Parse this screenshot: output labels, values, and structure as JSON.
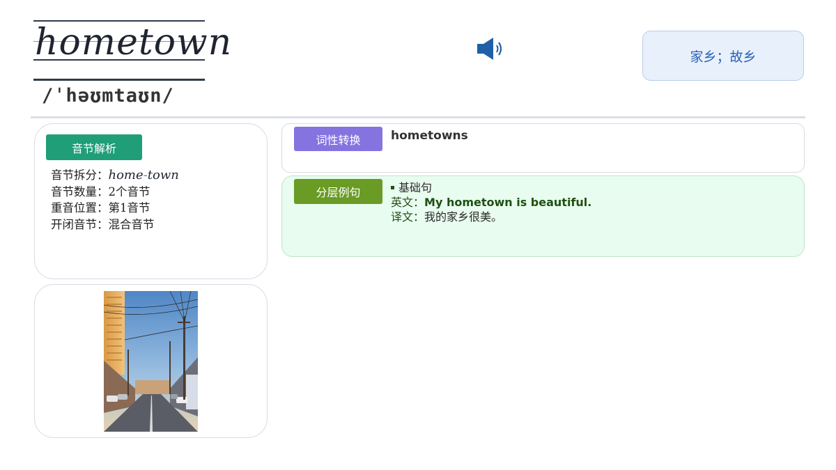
{
  "word": {
    "text": "hometown",
    "phonetic": "/ˈhəʊmtaʊn/"
  },
  "meaning": "家乡；故乡",
  "syllable_card": {
    "tag_label": "音节解析",
    "split_label": "音节拆分：",
    "split_parts": [
      "home",
      "-",
      "town"
    ],
    "count_label": "音节数量：",
    "count_value": "2个音节",
    "stress_label": "重音位置：",
    "stress_value": "第1音节",
    "type_label": "开闭音节：",
    "type_value": "混合音节"
  },
  "pos_card": {
    "tag_label": "词性转换",
    "value": "hometowns"
  },
  "example_card": {
    "tag_label": "分层例句",
    "level": "基础句",
    "en_label": "英文：",
    "en_text": "My hometown is beautiful.",
    "zh_label": "译文：",
    "zh_text": "我的家乡很美。"
  },
  "colors": {
    "meaning_bg": "#e8f0fb",
    "meaning_text": "#2a63b8",
    "tag_green": "#1f9e78",
    "tag_purple": "#8574e0",
    "tag_olive": "#6a9b24",
    "example_bg": "#e8fcef",
    "speaker": "#1f5fa8"
  },
  "icons": {
    "speaker": "speaker-icon"
  }
}
